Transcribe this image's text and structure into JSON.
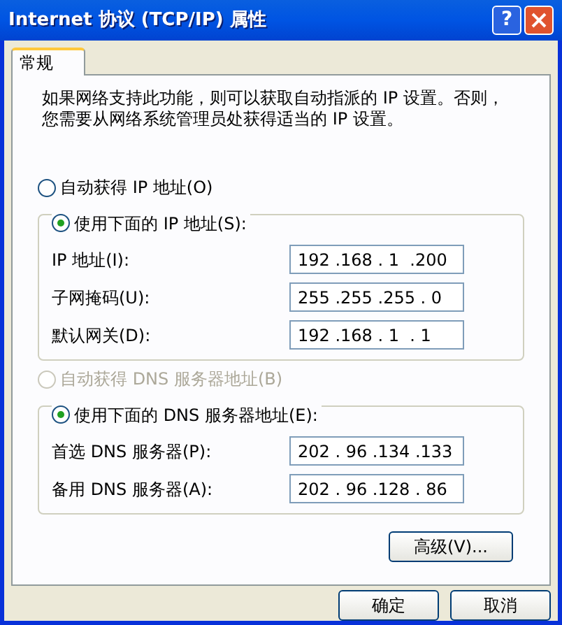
{
  "window": {
    "title": "Internet 协议 (TCP/IP) 属性",
    "help": "?"
  },
  "tabs": [
    {
      "label": "常规",
      "selected": true
    }
  ],
  "description": [
    "如果网络支持此功能，则可以获取自动指派的 IP 设置。否则，",
    "您需要从网络系统管理员处获得适当的 IP 设置。"
  ],
  "ip_options": [
    {
      "label": "自动获得 IP 地址(O)",
      "selected": false,
      "disabled": false
    },
    {
      "label": "使用下面的 IP 地址(S):",
      "selected": true,
      "disabled": false
    }
  ],
  "ip_fields": [
    {
      "label": "IP 地址(I):",
      "value": "192 .168 . 1  .200"
    },
    {
      "label": "子网掩码(U):",
      "value": "255 .255 .255 . 0"
    },
    {
      "label": "默认网关(D):",
      "value": "192 .168 . 1  . 1"
    }
  ],
  "dns_options": [
    {
      "label": "自动获得 DNS 服务器地址(B)",
      "selected": false,
      "disabled": true
    },
    {
      "label": "使用下面的 DNS 服务器地址(E):",
      "selected": true,
      "disabled": false
    }
  ],
  "dns_fields": [
    {
      "label": "首选 DNS 服务器(P):",
      "value": "202 . 96 .134 .133"
    },
    {
      "label": "备用 DNS 服务器(A):",
      "value": "202 . 96 .128 . 86"
    }
  ],
  "advanced_button": "高级(V)...",
  "buttons": [
    "确定",
    "取消"
  ]
}
